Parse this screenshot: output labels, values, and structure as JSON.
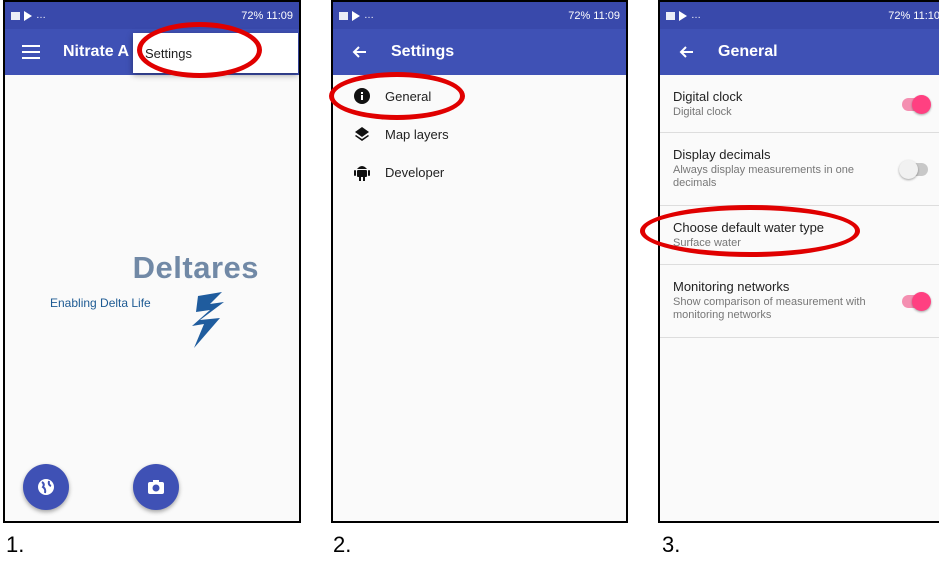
{
  "status": {
    "p1_right": "72%  11:09",
    "p2_right": "72%  11:09",
    "p3_right": "72%  11:10"
  },
  "panel1": {
    "title": "Nitrate A",
    "menu_item": "Settings",
    "logo_word": "Deltares",
    "logo_tagline": "Enabling Delta Life"
  },
  "panel2": {
    "title": "Settings",
    "items": [
      {
        "label": "General",
        "icon": "info-icon"
      },
      {
        "label": "Map layers",
        "icon": "layers-icon"
      },
      {
        "label": "Developer",
        "icon": "android-icon"
      }
    ]
  },
  "panel3": {
    "title": "General",
    "prefs": [
      {
        "title": "Digital clock",
        "summary": "Digital clock",
        "switch": "on"
      },
      {
        "title": "Display decimals",
        "summary": "Always display measurements in one decimals",
        "switch": "off"
      },
      {
        "title": "Choose default water type",
        "summary": "Surface water"
      },
      {
        "title": "Monitoring networks",
        "summary": "Show comparison of measurement with monitoring networks",
        "switch": "on"
      }
    ]
  },
  "captions": [
    "1.",
    "2.",
    "3."
  ],
  "colors": {
    "primary": "#3f51b5",
    "accent": "#ff4081",
    "highlight": "#e00000"
  }
}
